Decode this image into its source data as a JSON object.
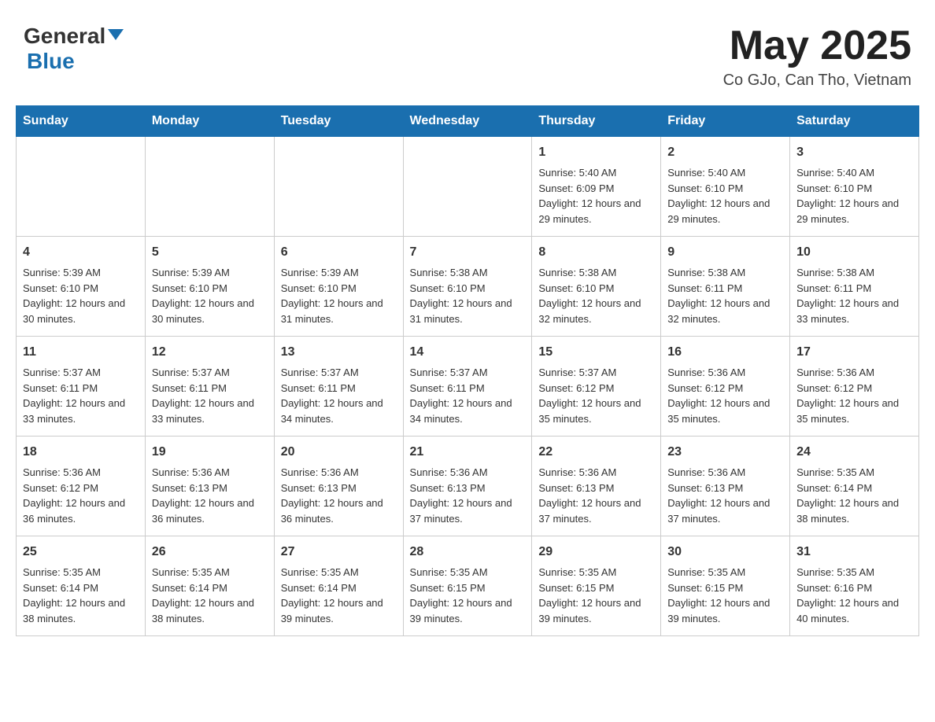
{
  "header": {
    "logo": {
      "general": "General",
      "blue": "Blue"
    },
    "month": "May 2025",
    "location": "Co GJo, Can Tho, Vietnam"
  },
  "days_of_week": [
    "Sunday",
    "Monday",
    "Tuesday",
    "Wednesday",
    "Thursday",
    "Friday",
    "Saturday"
  ],
  "weeks": [
    [
      {
        "day": "",
        "sunrise": "",
        "sunset": "",
        "daylight": ""
      },
      {
        "day": "",
        "sunrise": "",
        "sunset": "",
        "daylight": ""
      },
      {
        "day": "",
        "sunrise": "",
        "sunset": "",
        "daylight": ""
      },
      {
        "day": "",
        "sunrise": "",
        "sunset": "",
        "daylight": ""
      },
      {
        "day": "1",
        "sunrise": "Sunrise: 5:40 AM",
        "sunset": "Sunset: 6:09 PM",
        "daylight": "Daylight: 12 hours and 29 minutes."
      },
      {
        "day": "2",
        "sunrise": "Sunrise: 5:40 AM",
        "sunset": "Sunset: 6:10 PM",
        "daylight": "Daylight: 12 hours and 29 minutes."
      },
      {
        "day": "3",
        "sunrise": "Sunrise: 5:40 AM",
        "sunset": "Sunset: 6:10 PM",
        "daylight": "Daylight: 12 hours and 29 minutes."
      }
    ],
    [
      {
        "day": "4",
        "sunrise": "Sunrise: 5:39 AM",
        "sunset": "Sunset: 6:10 PM",
        "daylight": "Daylight: 12 hours and 30 minutes."
      },
      {
        "day": "5",
        "sunrise": "Sunrise: 5:39 AM",
        "sunset": "Sunset: 6:10 PM",
        "daylight": "Daylight: 12 hours and 30 minutes."
      },
      {
        "day": "6",
        "sunrise": "Sunrise: 5:39 AM",
        "sunset": "Sunset: 6:10 PM",
        "daylight": "Daylight: 12 hours and 31 minutes."
      },
      {
        "day": "7",
        "sunrise": "Sunrise: 5:38 AM",
        "sunset": "Sunset: 6:10 PM",
        "daylight": "Daylight: 12 hours and 31 minutes."
      },
      {
        "day": "8",
        "sunrise": "Sunrise: 5:38 AM",
        "sunset": "Sunset: 6:10 PM",
        "daylight": "Daylight: 12 hours and 32 minutes."
      },
      {
        "day": "9",
        "sunrise": "Sunrise: 5:38 AM",
        "sunset": "Sunset: 6:11 PM",
        "daylight": "Daylight: 12 hours and 32 minutes."
      },
      {
        "day": "10",
        "sunrise": "Sunrise: 5:38 AM",
        "sunset": "Sunset: 6:11 PM",
        "daylight": "Daylight: 12 hours and 33 minutes."
      }
    ],
    [
      {
        "day": "11",
        "sunrise": "Sunrise: 5:37 AM",
        "sunset": "Sunset: 6:11 PM",
        "daylight": "Daylight: 12 hours and 33 minutes."
      },
      {
        "day": "12",
        "sunrise": "Sunrise: 5:37 AM",
        "sunset": "Sunset: 6:11 PM",
        "daylight": "Daylight: 12 hours and 33 minutes."
      },
      {
        "day": "13",
        "sunrise": "Sunrise: 5:37 AM",
        "sunset": "Sunset: 6:11 PM",
        "daylight": "Daylight: 12 hours and 34 minutes."
      },
      {
        "day": "14",
        "sunrise": "Sunrise: 5:37 AM",
        "sunset": "Sunset: 6:11 PM",
        "daylight": "Daylight: 12 hours and 34 minutes."
      },
      {
        "day": "15",
        "sunrise": "Sunrise: 5:37 AM",
        "sunset": "Sunset: 6:12 PM",
        "daylight": "Daylight: 12 hours and 35 minutes."
      },
      {
        "day": "16",
        "sunrise": "Sunrise: 5:36 AM",
        "sunset": "Sunset: 6:12 PM",
        "daylight": "Daylight: 12 hours and 35 minutes."
      },
      {
        "day": "17",
        "sunrise": "Sunrise: 5:36 AM",
        "sunset": "Sunset: 6:12 PM",
        "daylight": "Daylight: 12 hours and 35 minutes."
      }
    ],
    [
      {
        "day": "18",
        "sunrise": "Sunrise: 5:36 AM",
        "sunset": "Sunset: 6:12 PM",
        "daylight": "Daylight: 12 hours and 36 minutes."
      },
      {
        "day": "19",
        "sunrise": "Sunrise: 5:36 AM",
        "sunset": "Sunset: 6:13 PM",
        "daylight": "Daylight: 12 hours and 36 minutes."
      },
      {
        "day": "20",
        "sunrise": "Sunrise: 5:36 AM",
        "sunset": "Sunset: 6:13 PM",
        "daylight": "Daylight: 12 hours and 36 minutes."
      },
      {
        "day": "21",
        "sunrise": "Sunrise: 5:36 AM",
        "sunset": "Sunset: 6:13 PM",
        "daylight": "Daylight: 12 hours and 37 minutes."
      },
      {
        "day": "22",
        "sunrise": "Sunrise: 5:36 AM",
        "sunset": "Sunset: 6:13 PM",
        "daylight": "Daylight: 12 hours and 37 minutes."
      },
      {
        "day": "23",
        "sunrise": "Sunrise: 5:36 AM",
        "sunset": "Sunset: 6:13 PM",
        "daylight": "Daylight: 12 hours and 37 minutes."
      },
      {
        "day": "24",
        "sunrise": "Sunrise: 5:35 AM",
        "sunset": "Sunset: 6:14 PM",
        "daylight": "Daylight: 12 hours and 38 minutes."
      }
    ],
    [
      {
        "day": "25",
        "sunrise": "Sunrise: 5:35 AM",
        "sunset": "Sunset: 6:14 PM",
        "daylight": "Daylight: 12 hours and 38 minutes."
      },
      {
        "day": "26",
        "sunrise": "Sunrise: 5:35 AM",
        "sunset": "Sunset: 6:14 PM",
        "daylight": "Daylight: 12 hours and 38 minutes."
      },
      {
        "day": "27",
        "sunrise": "Sunrise: 5:35 AM",
        "sunset": "Sunset: 6:14 PM",
        "daylight": "Daylight: 12 hours and 39 minutes."
      },
      {
        "day": "28",
        "sunrise": "Sunrise: 5:35 AM",
        "sunset": "Sunset: 6:15 PM",
        "daylight": "Daylight: 12 hours and 39 minutes."
      },
      {
        "day": "29",
        "sunrise": "Sunrise: 5:35 AM",
        "sunset": "Sunset: 6:15 PM",
        "daylight": "Daylight: 12 hours and 39 minutes."
      },
      {
        "day": "30",
        "sunrise": "Sunrise: 5:35 AM",
        "sunset": "Sunset: 6:15 PM",
        "daylight": "Daylight: 12 hours and 39 minutes."
      },
      {
        "day": "31",
        "sunrise": "Sunrise: 5:35 AM",
        "sunset": "Sunset: 6:16 PM",
        "daylight": "Daylight: 12 hours and 40 minutes."
      }
    ]
  ]
}
